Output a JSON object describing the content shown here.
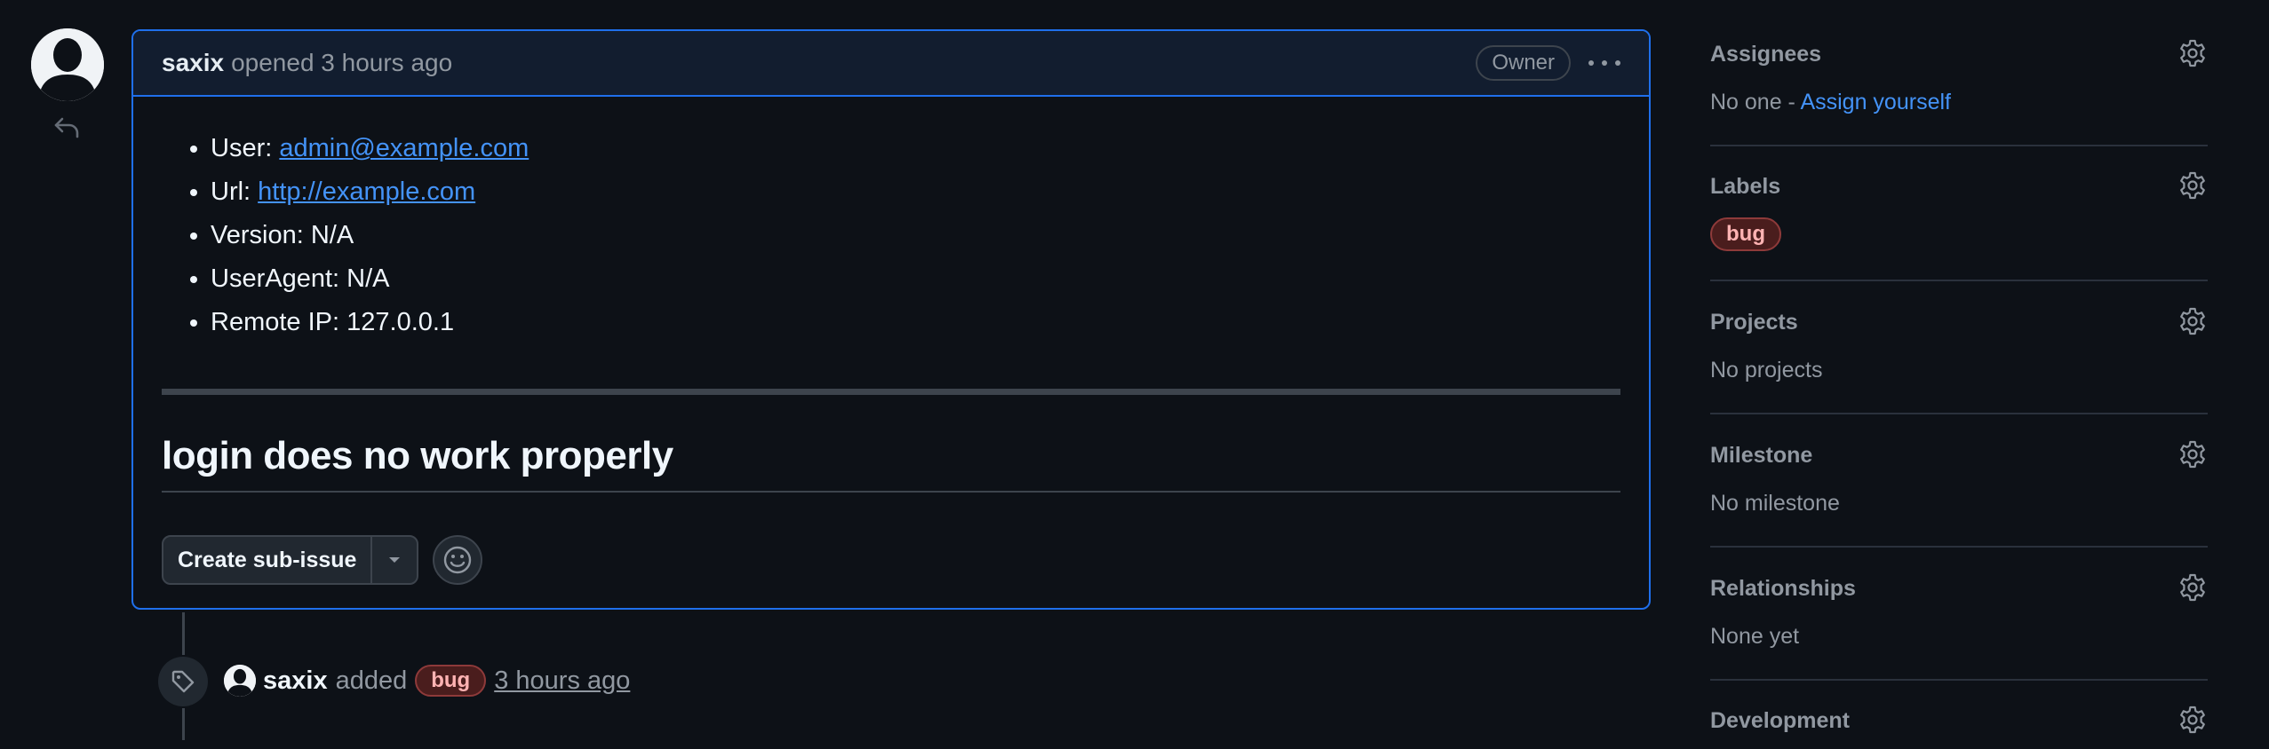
{
  "comment": {
    "author": "saxix",
    "opened_text": "opened 3 hours ago",
    "owner_badge": "Owner",
    "items": [
      {
        "label": "User:",
        "value": "admin@example.com",
        "is_link": true
      },
      {
        "label": "Url:",
        "value": "http://example.com",
        "is_link": true
      },
      {
        "label": "Version:",
        "value": "N/A",
        "is_link": false
      },
      {
        "label": "UserAgent:",
        "value": "N/A",
        "is_link": false
      },
      {
        "label": "Remote IP:",
        "value": "127.0.0.1",
        "is_link": false
      }
    ],
    "title": "login does no work properly",
    "create_sub_issue_label": "Create sub-issue"
  },
  "event": {
    "author": "saxix",
    "verb": "added",
    "label": "bug",
    "time": "3 hours ago"
  },
  "sidebar": {
    "assignees": {
      "title": "Assignees",
      "value": "No one - ",
      "link": "Assign yourself"
    },
    "labels": {
      "title": "Labels",
      "label": "bug"
    },
    "projects": {
      "title": "Projects",
      "value": "No projects"
    },
    "milestone": {
      "title": "Milestone",
      "value": "No milestone"
    },
    "relationships": {
      "title": "Relationships",
      "value": "None yet"
    },
    "development": {
      "title": "Development"
    }
  },
  "colors": {
    "background": "#0d1117",
    "accent_border": "#1f6feb",
    "link": "#4493f8",
    "bug_label_bg": "#4a1d1d",
    "bug_label_text": "#ffb3b3"
  },
  "icons": [
    "avatar-icon",
    "reply-icon",
    "kebab-menu-icon",
    "caret-down-icon",
    "smiley-icon",
    "tag-icon",
    "gear-icon"
  ]
}
